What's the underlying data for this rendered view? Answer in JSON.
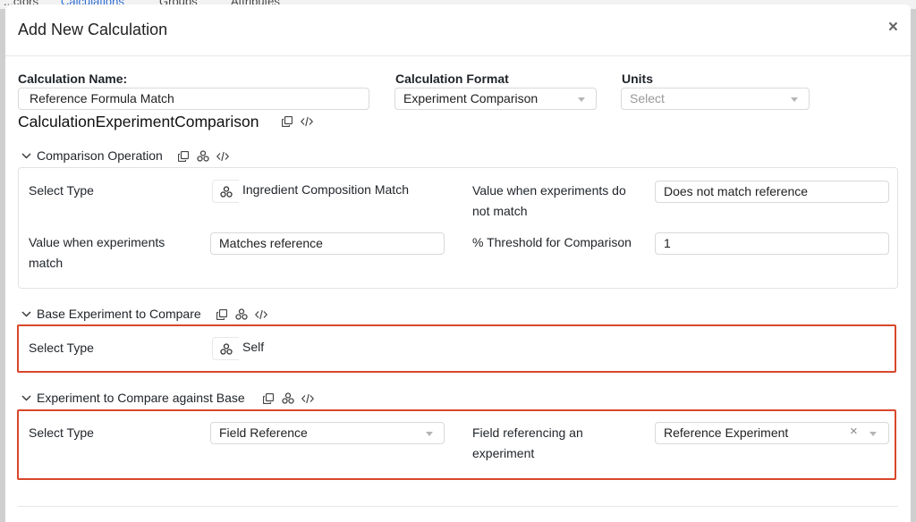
{
  "background_tabs": [
    "...ctors",
    "Calculations",
    "Groups",
    "Attributes"
  ],
  "modal": {
    "title": "Add New Calculation",
    "close_glyph": "×"
  },
  "form": {
    "name_label": "Calculation Name:",
    "name_value": "Reference Formula Match",
    "format_label": "Calculation Format",
    "format_value": "Experiment Comparison",
    "units_label": "Units",
    "units_placeholder": "Select",
    "calc_type_title": "CalculationExperimentComparison"
  },
  "sections": {
    "comparison": {
      "title": "Comparison Operation",
      "select_type_label": "Select Type",
      "select_type_value": "Ingredient Composition Match",
      "no_match_label_1": "Value when experiments do",
      "no_match_label_2": "not match",
      "no_match_value": "Does not match reference",
      "match_label_1": "Value when experiments",
      "match_label_2": "match",
      "match_value": "Matches reference",
      "threshold_label": "% Threshold for Comparison",
      "threshold_value": "1"
    },
    "base": {
      "title": "Base Experiment to Compare",
      "select_type_label": "Select Type",
      "select_type_value": "Self"
    },
    "against": {
      "title": "Experiment to Compare against Base",
      "select_type_label": "Select Type",
      "select_type_value": "Field Reference",
      "field_ref_label_1": "Field referencing an",
      "field_ref_label_2": "experiment",
      "field_ref_value": "Reference Experiment",
      "clear_glyph": "×"
    }
  },
  "icons": {
    "copy": "copy-icon",
    "tree": "tree-icon",
    "code": "code-icon",
    "chevron": "chevron-down-icon"
  },
  "colors": {
    "highlight": "#d9472b",
    "link_active": "#2f6fd6"
  }
}
